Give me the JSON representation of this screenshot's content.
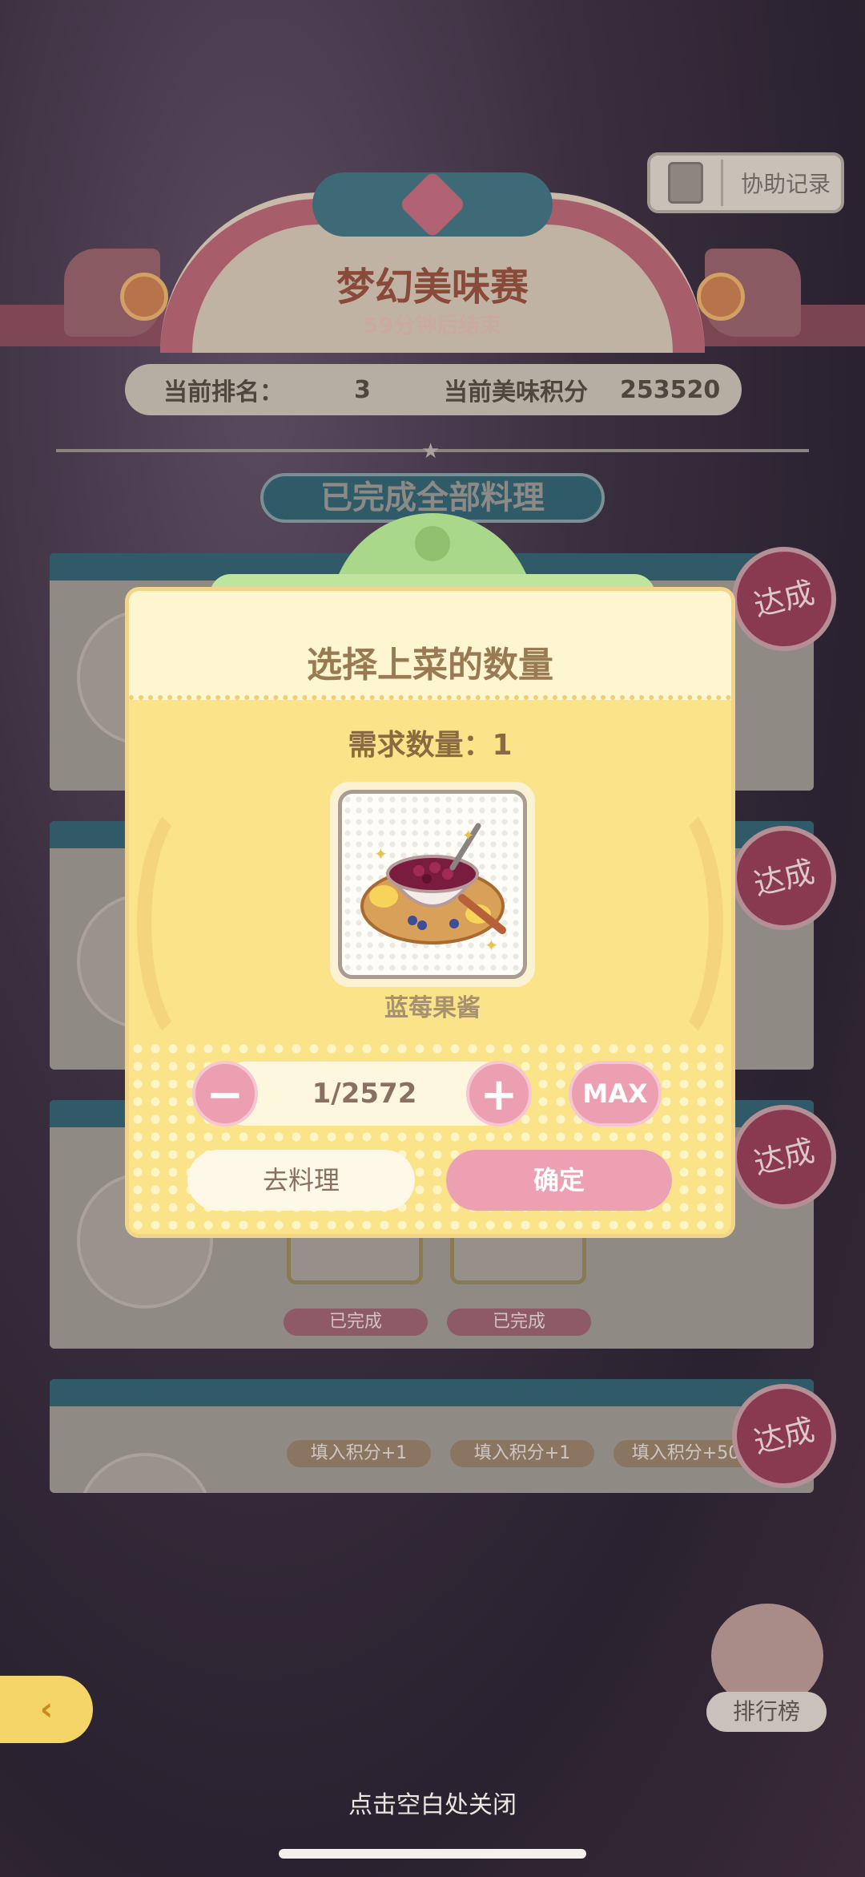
{
  "header": {
    "assist_label": "协助记录",
    "event_title": "梦幻美味赛",
    "event_countdown": "59分钟后结束",
    "rank_label": "当前排名：",
    "rank_value": "3",
    "score_label": "当前美味积分",
    "score_value": "253520",
    "status_tag": "已完成全部料理"
  },
  "cards": {
    "stamp_label": "达成",
    "completed_label": "已完成",
    "bonus_labels": [
      "填入积分+1",
      "填入积分+1",
      "填入积分+50"
    ]
  },
  "modal": {
    "title": "选择上菜的数量",
    "demand_label": "需求数量：1",
    "item_name": "蓝莓果酱",
    "item_icon": "blueberry-jam-bowl",
    "quantity_value": "1/2572",
    "minus_label": "−",
    "plus_label": "+",
    "max_label": "MAX",
    "cook_label": "去料理",
    "confirm_label": "确定"
  },
  "footer": {
    "leaderboard_label": "排行榜",
    "close_hint": "点击空白处关闭"
  },
  "colors": {
    "modal_bg": "#fbe38a",
    "accent_pink": "#eca0b2",
    "clip_green": "#a9d88a"
  }
}
